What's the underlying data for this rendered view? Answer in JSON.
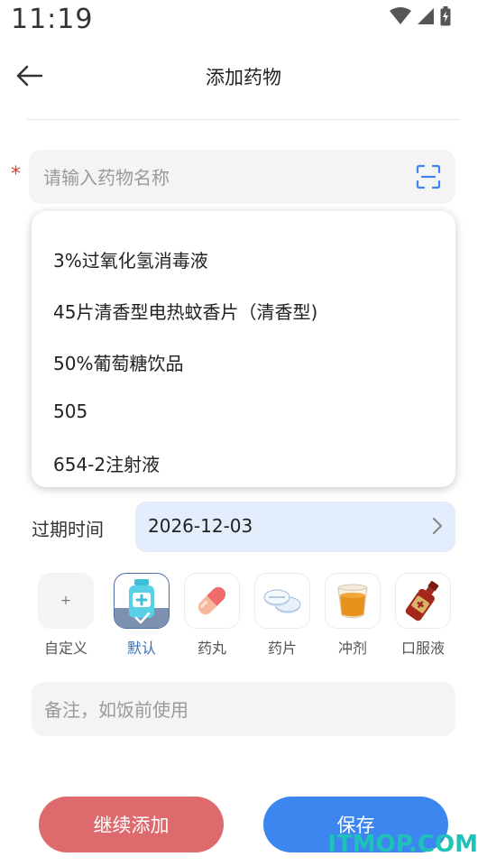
{
  "status_bar": {
    "time": "11:19"
  },
  "header": {
    "title": "添加药物"
  },
  "form": {
    "required_mark": "*",
    "name_input": {
      "placeholder": "请输入药物名称",
      "value": ""
    },
    "suggestions": [
      "3%过氧化氢消毒液",
      "45片清香型电热蚊香片（清香型)",
      "50%葡萄糖饮品",
      "505",
      "654-2注射液"
    ],
    "expiry": {
      "label": "过期时间",
      "value": "2026-12-03"
    },
    "dosage_forms": [
      {
        "label": "自定义",
        "icon": "plus-icon"
      },
      {
        "label": "默认",
        "icon": "medicine-bottle-icon",
        "selected": true
      },
      {
        "label": "药丸",
        "icon": "capsule-icon"
      },
      {
        "label": "药片",
        "icon": "tablet-icon"
      },
      {
        "label": "冲剂",
        "icon": "granule-cup-icon"
      },
      {
        "label": "口服液",
        "icon": "oral-liquid-bottle-icon"
      }
    ],
    "custom_plus": "+",
    "note_input": {
      "placeholder": "备注，如饭前使用",
      "value": ""
    }
  },
  "buttons": {
    "continue_label": "继续添加",
    "save_label": "保存"
  },
  "watermark": "ITMOP.COM",
  "colors": {
    "accent": "#3d86f0",
    "danger": "#dd6b6e",
    "expiry_bg": "#e3edfb",
    "selected_border": "#4b6fa5"
  }
}
